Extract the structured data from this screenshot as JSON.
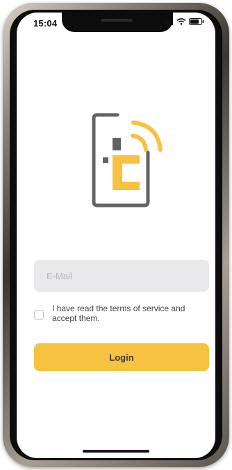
{
  "status_bar": {
    "time": "15:04",
    "icons": [
      "signal-icon",
      "wifi-icon",
      "battery-icon"
    ]
  },
  "logo": {
    "icon": "phone-signal-logo-icon",
    "colors": {
      "gray": "#636363",
      "yellow": "#f7c23f"
    }
  },
  "login_form": {
    "email_placeholder": "E-Mail",
    "email_value": "",
    "terms_label": "I have read the terms of service and accept them.",
    "terms_checked": false,
    "login_label": "Login"
  },
  "theme": {
    "accent": "#f7c23f",
    "field_background": "#e9e9eb"
  }
}
